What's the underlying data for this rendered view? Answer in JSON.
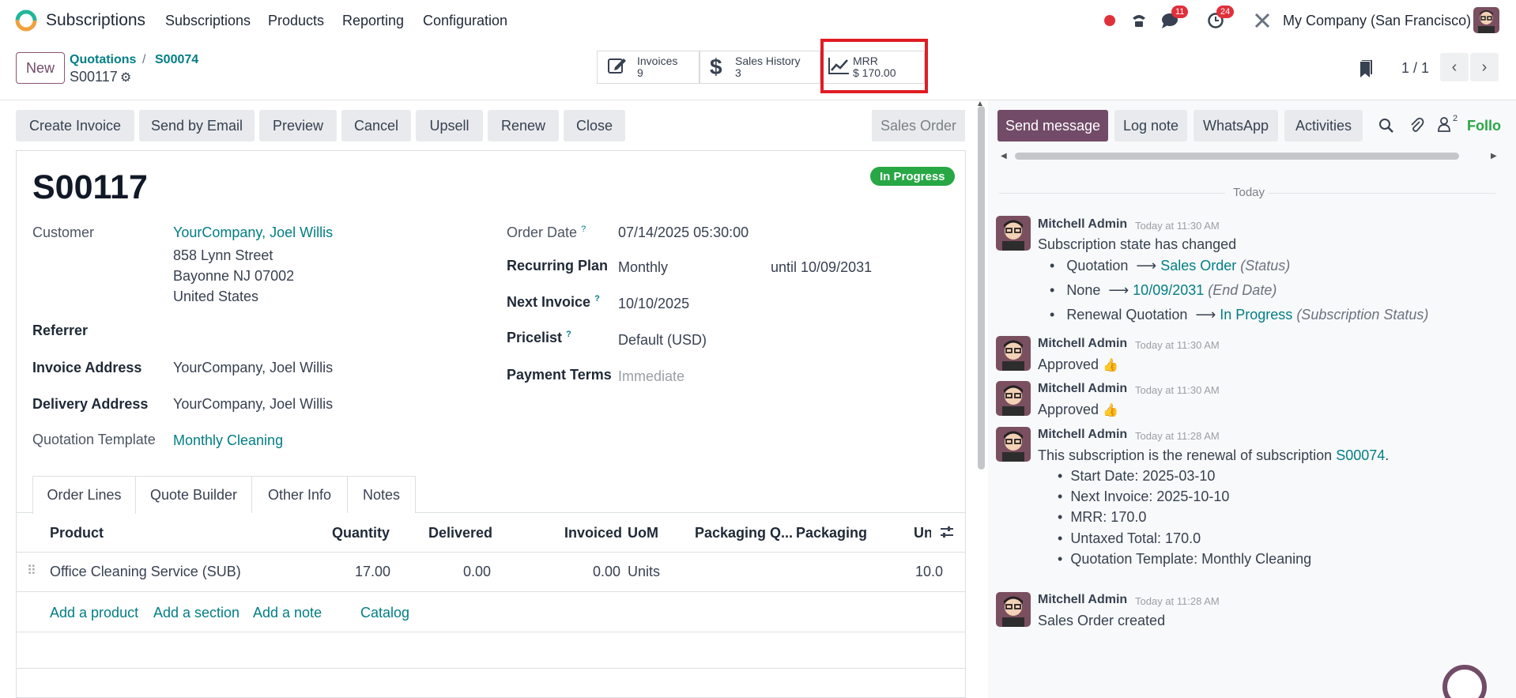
{
  "app": {
    "name": "Subscriptions"
  },
  "menu": [
    "Subscriptions",
    "Products",
    "Reporting",
    "Configuration"
  ],
  "systray": {
    "messages_count": "11",
    "activities_count": "24",
    "company": "My Company (San Francisco)"
  },
  "breadcrumb": {
    "parent": "Quotations",
    "current": "S00074",
    "record": "S00117"
  },
  "new_label": "New",
  "stat_buttons": [
    {
      "label": "Invoices",
      "value": "9",
      "icon": "pencil-square-icon"
    },
    {
      "label": "Sales History",
      "value": "3",
      "icon": "dollar-icon"
    },
    {
      "label": "MRR",
      "value": "$ 170.00",
      "icon": "trend-chart-icon"
    }
  ],
  "pager": {
    "text": "1 / 1"
  },
  "actions": [
    "Create Invoice",
    "Send by Email",
    "Preview",
    "Cancel",
    "Upsell",
    "Renew",
    "Close"
  ],
  "stage": "Sales Order",
  "form": {
    "title": "S00117",
    "status": "In Progress",
    "customer_label": "Customer",
    "customer_name": "YourCompany, Joel Willis",
    "address_line1": "858 Lynn Street",
    "address_line2": "Bayonne NJ 07002",
    "address_line3": "United States",
    "referrer_label": "Referrer",
    "invoice_address_label": "Invoice Address",
    "invoice_address": "YourCompany, Joel Willis",
    "delivery_address_label": "Delivery Address",
    "delivery_address": "YourCompany, Joel Willis",
    "template_label": "Quotation Template",
    "template": "Monthly Cleaning",
    "order_date_label": "Order Date",
    "order_date": "07/14/2025 05:30:00",
    "plan_label": "Recurring Plan",
    "plan": "Monthly",
    "until": "until 10/09/2031",
    "next_invoice_label": "Next Invoice",
    "next_invoice": "10/10/2025",
    "pricelist_label": "Pricelist",
    "pricelist": "Default (USD)",
    "payment_terms_label": "Payment Terms",
    "payment_terms_placeholder": "Immediate",
    "help_mark": "?"
  },
  "tabs": [
    "Order Lines",
    "Quote Builder",
    "Other Info",
    "Notes"
  ],
  "table": {
    "headers": [
      "Product",
      "Quantity",
      "Delivered",
      "Invoiced",
      "UoM",
      "Packaging Q...",
      "Packaging",
      "Uni"
    ],
    "row": {
      "product": "Office Cleaning Service (SUB)",
      "quantity": "17.00",
      "delivered": "0.00",
      "invoiced": "0.00",
      "uom": "Units",
      "unit": "10.0"
    },
    "add_links": [
      "Add a product",
      "Add a section",
      "Add a note",
      "Catalog"
    ]
  },
  "chatter": {
    "buttons": [
      "Send message",
      "Log note",
      "WhatsApp",
      "Activities"
    ],
    "follow": "Follo",
    "followers_count": "2",
    "today": "Today",
    "messages": [
      {
        "author": "Mitchell Admin",
        "time": "Today at 11:30 AM",
        "body": "Subscription state has changed",
        "changes": [
          {
            "from": "Quotation",
            "to": "Sales Order",
            "field": "(Status)"
          },
          {
            "from": "None",
            "to": "10/09/2031",
            "field": "(End Date)"
          },
          {
            "from": "Renewal Quotation",
            "to": "In Progress",
            "field": "(Subscription Status)"
          }
        ]
      },
      {
        "author": "Mitchell Admin",
        "time": "Today at 11:30 AM",
        "body": "Approved"
      },
      {
        "author": "Mitchell Admin",
        "time": "Today at 11:30 AM",
        "body": "Approved"
      },
      {
        "author": "Mitchell Admin",
        "time": "Today at 11:28 AM",
        "body": "This subscription is the renewal of subscription",
        "link": "S00074",
        "items": [
          "Start Date: 2025-03-10",
          "Next Invoice: 2025-10-10",
          "MRR: 170.0",
          "Untaxed Total: 170.0",
          "Quotation Template: Monthly Cleaning"
        ]
      },
      {
        "author": "Mitchell Admin",
        "time": "Today at 11:28 AM",
        "body": "Sales Order created"
      }
    ]
  },
  "colors": {
    "brand": "#714B67",
    "link": "#017e84",
    "success": "#28a745",
    "highlight": "#e01c24"
  }
}
